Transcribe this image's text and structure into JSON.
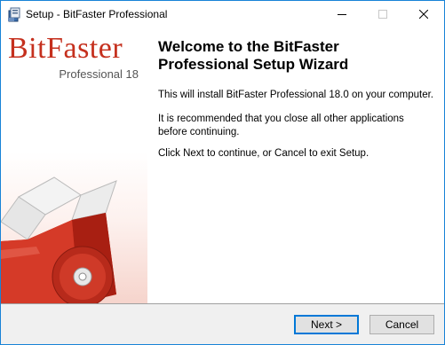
{
  "window": {
    "title": "Setup - BitFaster Professional"
  },
  "banner": {
    "brand": "BitFaster",
    "edition": "Professional 18"
  },
  "main": {
    "heading": "Welcome to the BitFaster Professional Setup Wizard",
    "paragraphs": [
      "This will install BitFaster Professional 18.0 on your computer.",
      "It is recommended that you close all other applications before continuing.",
      "Click Next to continue, or Cancel to exit Setup."
    ]
  },
  "buttons": {
    "next": "Next >",
    "cancel": "Cancel"
  },
  "colors": {
    "brand_red": "#c5301e",
    "focus_blue": "#0078d7"
  },
  "icons": {
    "app": "setup-installer-icon",
    "minimize": "minimize-icon",
    "maximize": "maximize-icon",
    "close": "close-icon"
  }
}
